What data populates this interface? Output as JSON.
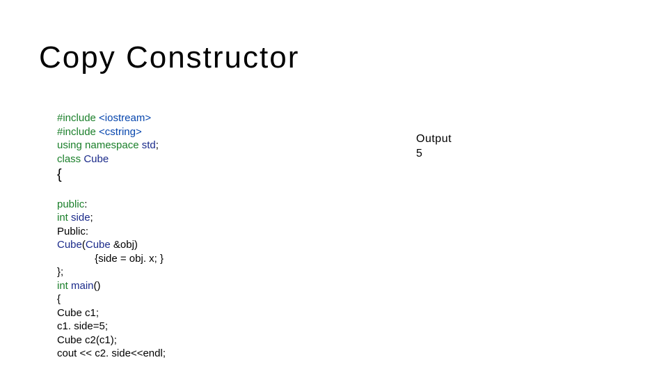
{
  "title": "Copy Constructor",
  "code": {
    "l1a": "#include ",
    "l1b": "<iostream>",
    "l2a": "#include ",
    "l2b": "<cstring>",
    "l3a": "using ",
    "l3b": "namespace ",
    "l3c": "std",
    "l3d": ";",
    "l4a": "class ",
    "l4b": "Cube",
    "l5": "{",
    "l6a": "public",
    "l6b": ":",
    "l7a": "int ",
    "l7b": "side",
    "l7c": ";",
    "l8a": "Public",
    "l8b": ":",
    "l9a": "Cube",
    "l9b": "(",
    "l9c": "Cube ",
    "l9d": "&obj",
    "l9e": ")",
    "l10a": "             {",
    "l10b": "side = obj. x",
    "l10c": "; }",
    "l11a": "};",
    "l12a": "int ",
    "l12b": "main",
    "l12c": "()",
    "l13": "{",
    "l14a": "Cube c",
    "l14b": "1;",
    "l15a": "c",
    "l15b": "1. ",
    "l15c": "side",
    "l15d": "=5;",
    "l16a": "Cube c",
    "l16b": "2(c",
    "l16c": "1);",
    "l17a": "cout << c",
    "l17b": "2. ",
    "l17c": "side",
    "l17d": "<<endl",
    "l17e": ";"
  },
  "output": {
    "label": "Output",
    "value": "5"
  }
}
